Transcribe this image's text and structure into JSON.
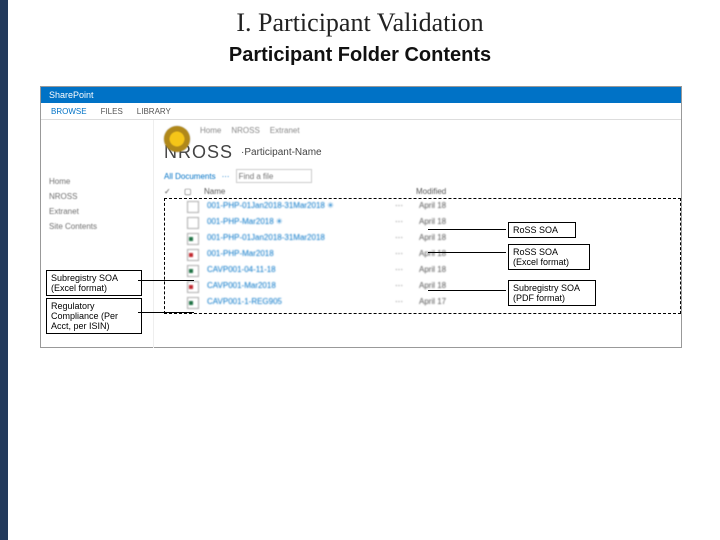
{
  "title": "I. Participant Validation",
  "subtitle": "Participant Folder Contents",
  "sp": {
    "brand": "SharePoint",
    "tabs": [
      "BROWSE",
      "FILES",
      "LIBRARY"
    ],
    "nav": [
      "Home",
      "NROSS",
      "Extranet",
      "Site Contents"
    ],
    "breadcrumb": [
      "Home",
      "NROSS",
      "Extranet"
    ],
    "site_title": "NROSS",
    "library": "·Participant-Name",
    "view": "All Documents",
    "search_placeholder": "Find a file",
    "columns": [
      "Name",
      "Modified"
    ],
    "files": [
      {
        "name": "001-PHP-01Jan2018-31Mar2018 ✳",
        "modified": "April 18"
      },
      {
        "name": "001-PHP-Mar2018 ✳",
        "modified": "April 18"
      },
      {
        "name": "001-PHP-01Jan2018-31Mar2018",
        "modified": "April 18"
      },
      {
        "name": "001-PHP-Mar2018",
        "modified": "April 18"
      },
      {
        "name": "CAVP001-04-11-18",
        "modified": "April 18"
      },
      {
        "name": "CAVP001-Mar2018",
        "modified": "April 18"
      },
      {
        "name": "CAVP001-1-REG905",
        "modified": "April 17"
      }
    ]
  },
  "annotations": [
    "Subregistry SOA (Excel format)",
    "Regulatory Compliance (Per Acct, per ISIN)",
    "RoSS SOA",
    "RoSS SOA (Excel format)",
    "Subregistry SOA (PDF format)"
  ]
}
